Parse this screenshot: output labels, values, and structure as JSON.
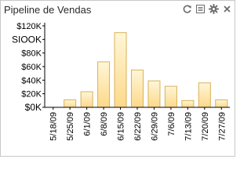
{
  "widget": {
    "title": "Pipeline de Vendas",
    "tools": [
      {
        "name": "refresh-icon",
        "label": "refresh"
      },
      {
        "name": "list-icon",
        "label": "list"
      },
      {
        "name": "gear-icon",
        "label": "settings"
      },
      {
        "name": "close-icon",
        "label": "close"
      }
    ]
  },
  "colors": {
    "bar_fill_top": "#fff6d8",
    "bar_fill_bottom": "#fcd98a",
    "bar_stroke": "#d9b25a",
    "axis": "#000000",
    "text": "#000000",
    "icon": "#6b6b6b"
  },
  "chart_data": {
    "type": "bar",
    "categories": [
      "5/18/09",
      "5/25/09",
      "6/1/09",
      "6/8/09",
      "6/15/09",
      "6/22/09",
      "6/29/09",
      "7/6/09",
      "7/13/09",
      "7/20/09",
      "7/27/09"
    ],
    "values": [
      0,
      11000,
      23000,
      67000,
      110000,
      55000,
      39000,
      31000,
      10000,
      36000,
      11000
    ],
    "ylim": [
      0,
      120000
    ],
    "yticks": [
      0,
      20000,
      40000,
      60000,
      80000,
      100000,
      120000
    ],
    "ytick_labels": [
      "$0K",
      "$20K",
      "$40K",
      "$60K",
      "$80K",
      "SIOOK",
      "$120K"
    ],
    "title": "",
    "xlabel": "",
    "ylabel": "",
    "grid": false,
    "legend": "none"
  }
}
